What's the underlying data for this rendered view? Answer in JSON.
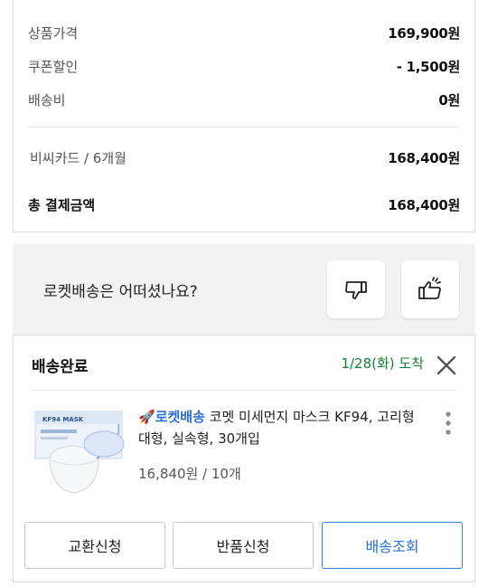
{
  "summary": {
    "rows": [
      {
        "label": "상품가격",
        "value": "169,900원"
      },
      {
        "label": "쿠폰할인",
        "value": "- 1,500원"
      },
      {
        "label": "배송비",
        "value": "0원"
      }
    ],
    "payment_method": {
      "label": "비씨카드 / 6개월",
      "value": "168,400원"
    },
    "total": {
      "label": "총 결제금액",
      "value": "168,400원"
    }
  },
  "feedback": {
    "question": "로켓배송은 어떠셨나요?",
    "icons": [
      "thumbs-down-icon",
      "thumbs-up-icon"
    ]
  },
  "delivery": {
    "status": "배송완료",
    "arrival": "1/28(화) 도착",
    "product": {
      "badge": "로켓배송",
      "name": " 코멧 미세먼지 마스크 KF94, 고리형 대형, 실속형, 30개입",
      "price_qty": "16,840원 / 10개",
      "image_text": "KF94 MASK"
    },
    "buttons": {
      "exchange": "교환신청",
      "return": "반품신청",
      "track": "배송조회"
    }
  },
  "colors": {
    "accent_blue": "#2a6fd6",
    "arrival_green": "#138034",
    "rocket_red": "#e33b2f"
  }
}
